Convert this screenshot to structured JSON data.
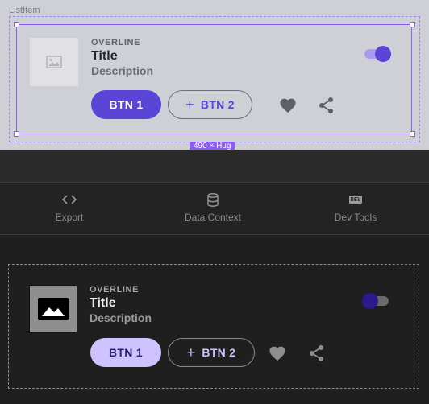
{
  "canvas": {
    "component_label": "ListItem",
    "size_chip": "490 × Hug"
  },
  "list_item_light": {
    "overline": "OVERLINE",
    "title": "Title",
    "description": "Description",
    "btn1": "BTN 1",
    "btn2": "BTN 2",
    "toggle_on": true
  },
  "toolbar": {
    "items": [
      {
        "label": "Export",
        "icon": "code-icon"
      },
      {
        "label": "Data Context",
        "icon": "database-icon"
      },
      {
        "label": "Dev Tools",
        "icon": "dev-icon",
        "chip": "DEV"
      }
    ]
  },
  "list_item_dark": {
    "overline": "OVERLINE",
    "title": "Title",
    "description": "Description",
    "btn1": "BTN 1",
    "btn2": "BTN 2",
    "toggle_on": false
  },
  "colors": {
    "accent": "#5b45d6",
    "accent_light": "#cfc3ff",
    "canvas_bg": "#cfcfd6",
    "panel_bg": "#1f1f1f",
    "selection": "#8b5cf6"
  }
}
